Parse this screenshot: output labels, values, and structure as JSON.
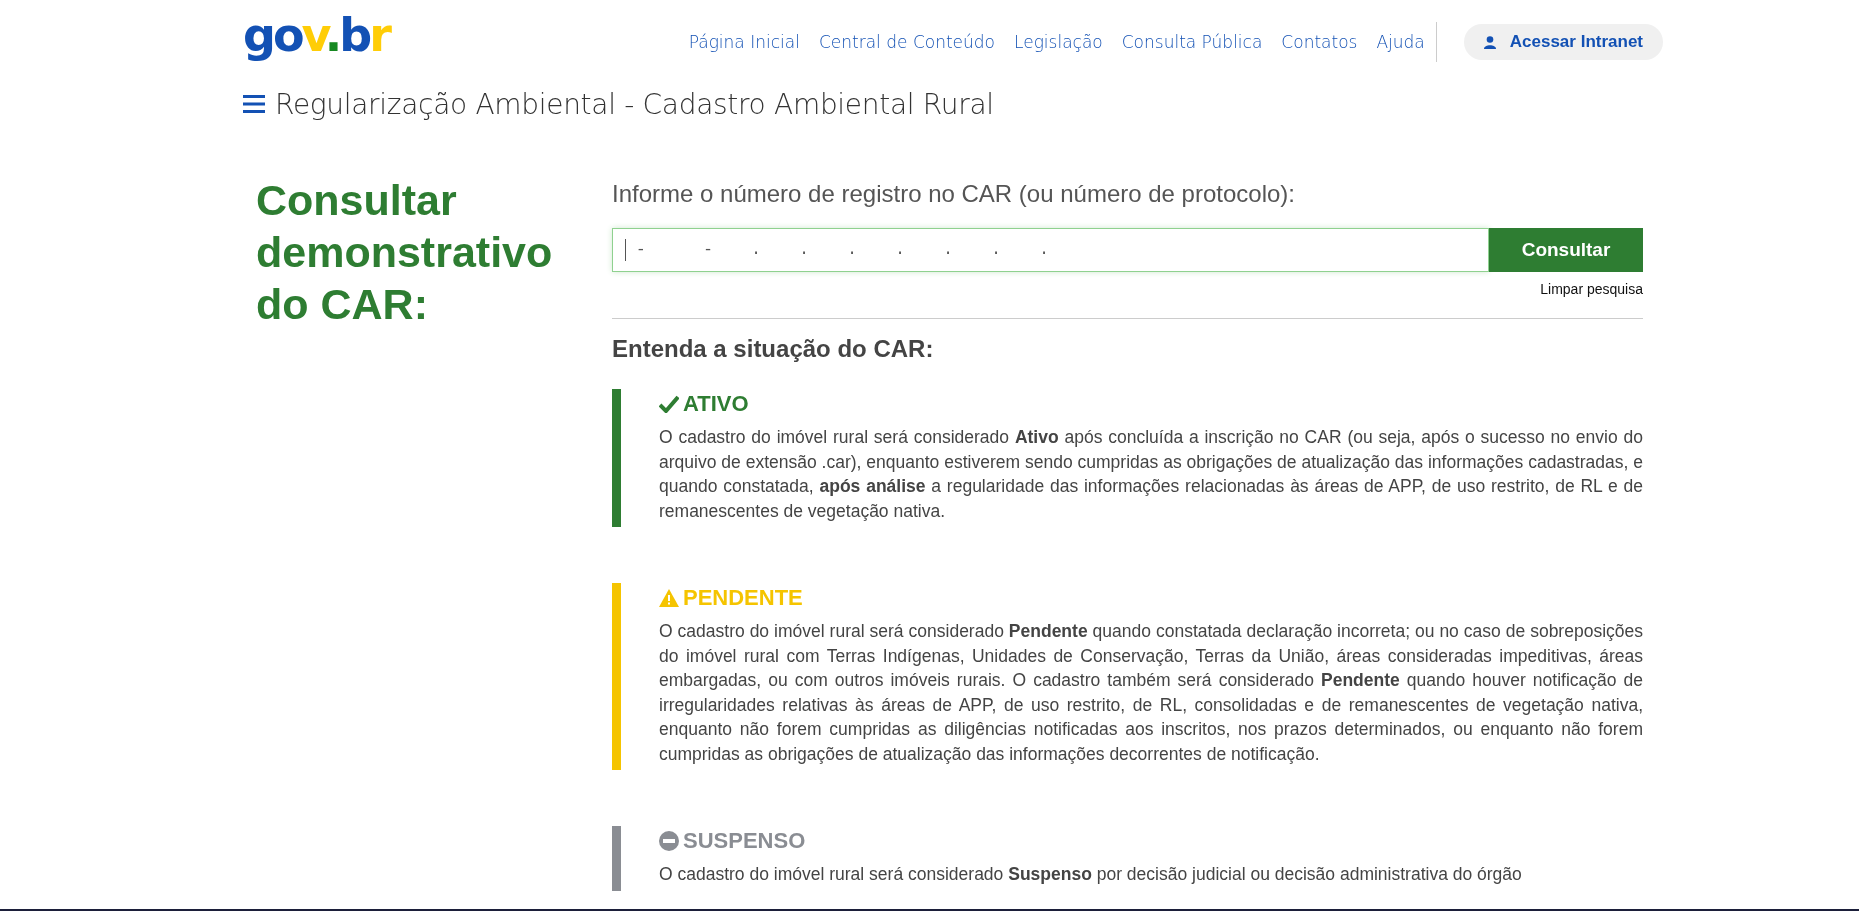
{
  "header": {
    "logo": {
      "parts": [
        {
          "text": "g",
          "color": "#1351b4"
        },
        {
          "text": "o",
          "color": "#1351b4"
        },
        {
          "text": "v",
          "color": "#ffcd07"
        },
        {
          "text": ".",
          "color": "#168821"
        },
        {
          "text": "b",
          "color": "#1351b4"
        },
        {
          "text": "r",
          "color": "#ffcd07"
        }
      ]
    },
    "nav": [
      "Página Inicial",
      "Central de Conteúdo",
      "Legislação",
      "Consulta Pública",
      "Contatos",
      "Ajuda"
    ],
    "login_button": "Acessar Intranet",
    "site_title": "Regularização Ambiental - Cadastro Ambiental Rural"
  },
  "page_heading": "Consultar demonstrativo do CAR:",
  "search": {
    "label": "Informe o número de registro no CAR (ou número de protocolo):",
    "mask": "-      -    .    .    .    .    .    .    .",
    "button": "Consultar",
    "clear_link": "Limpar pesquisa"
  },
  "situations": {
    "title": "Entenda a situação do CAR:",
    "items": [
      {
        "kind": "check",
        "color": "#2e7d32",
        "name": "ATIVO",
        "text": "O cadastro do imóvel rural será considerado **Ativo** após concluída a inscrição no CAR (ou seja, após o sucesso no envio do arquivo de extensão .car), enquanto estiverem sendo cumpridas as obrigações de atualização das informações cadastradas, e quando constatada, **após análise** a regularidade das informações relacionadas às áreas de APP, de uso restrito, de RL e de remanescentes de vegetação nativa."
      },
      {
        "kind": "warning",
        "color": "#f5c400",
        "name": "PENDENTE",
        "text": "O cadastro do imóvel rural será considerado **Pendente** quando constatada declaração incorreta; ou no caso de sobreposições do imóvel rural com Terras Indígenas, Unidades de Conservação, Terras da União, áreas consideradas impeditivas, áreas embargadas, ou com outros imóveis rurais. O cadastro também será considerado **Pendente** quando houver notificação de irregularidades relativas às áreas de APP, de uso restrito, de RL, consolidadas e de remanescentes de vegetação nativa, enquanto não forem cumpridas as diligências notificadas aos inscritos, nos prazos determinados, ou enquanto não forem cumpridas as obrigações de atualização das informações decorrentes de notificação."
      },
      {
        "kind": "minus",
        "color": "#8a8d93",
        "name": "SUSPENSO",
        "text": "O cadastro do imóvel rural será considerado **Suspenso** por decisão judicial ou decisão administrativa do órgão"
      }
    ]
  }
}
